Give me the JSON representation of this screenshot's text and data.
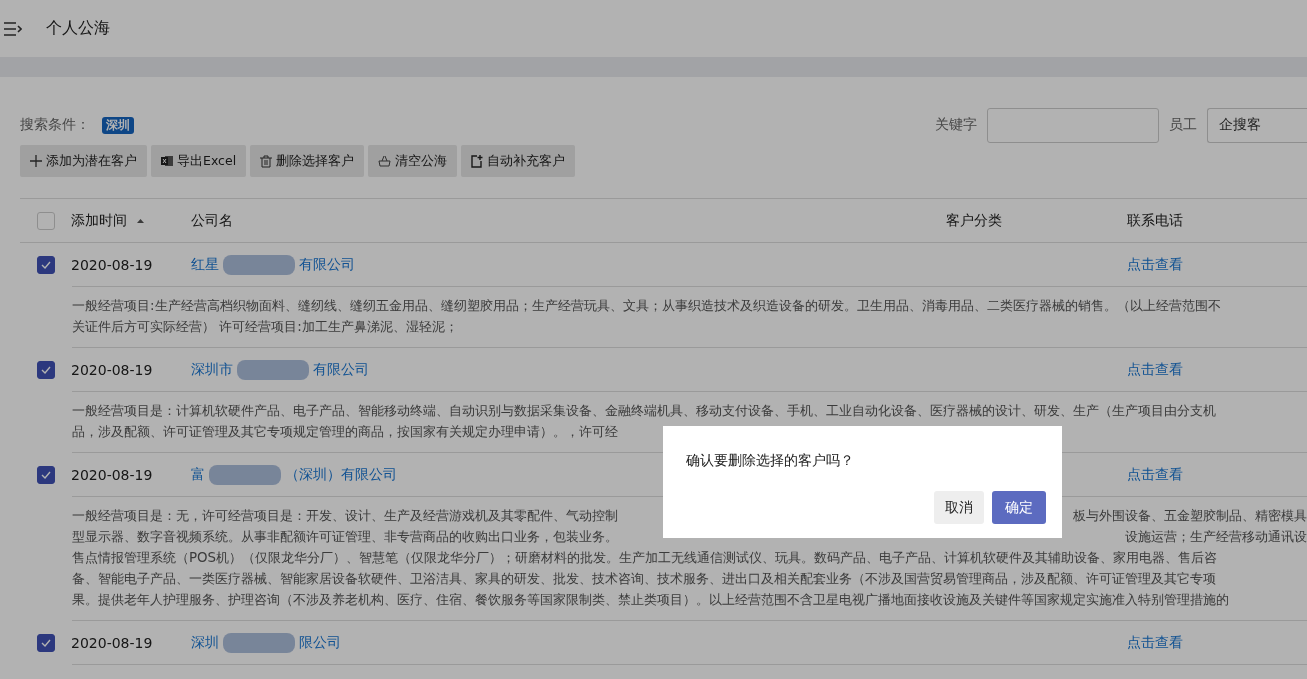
{
  "header": {
    "title": "个人公海"
  },
  "search": {
    "label": "搜索条件：",
    "tags": [
      "深圳"
    ],
    "keyword_label": "关键字",
    "employee_label": "员工",
    "employee_value": "企搜客"
  },
  "toolbar": [
    {
      "kind": "plus",
      "label": "添加为潜在客户"
    },
    {
      "kind": "excel",
      "label": "导出Excel"
    },
    {
      "kind": "trash",
      "label": "删除选择客户"
    },
    {
      "kind": "basket",
      "label": "清空公海"
    },
    {
      "kind": "refill",
      "label": "自动补充客户"
    }
  ],
  "table": {
    "select_all_checked": false,
    "columns": [
      "添加时间",
      "公司名",
      "客户分类",
      "联系电话"
    ],
    "rows": [
      {
        "checked": true,
        "date": "2020-08-19",
        "name_start": "红星",
        "name_end": "有限公司",
        "phone": "点击查看",
        "description": [
          [
            "一般经营项目:生产经营高档织物面料、缝纫线、缝纫五金用品、缝纫塑胶用品；生产经营玩具、文具；从事织造技术及织造设备的研发。卫生用品、消毒用品、二类医疗器械的销售。（以上经营范围不"
          ],
          [
            "关证件后方可实际经营） 许可经营项目:加工生产鼻涕泥、湿轻泥；"
          ]
        ]
      },
      {
        "checked": true,
        "date": "2020-08-19",
        "name_start": "深圳市",
        "name_end": "有限公司",
        "phone": "点击查看",
        "description": [
          [
            "一般经营项目是：计算机软硬件产品、电子产品、智能移动终端、自动识别与数据采集设备、金融终端机具、移动支付设备、手机、工业自动化设备、医疗器械的设计、研发、生产（生产项目由分支机"
          ],
          [
            "品，涉及配额、许可证管理及其它专项规定管理的商品，按国家有关规定办理申请）。，许可经"
          ]
        ]
      },
      {
        "checked": true,
        "date": "2020-08-19",
        "name_start": "富",
        "name_end": "（深圳）有限公司",
        "phone": "点击查看",
        "description": [
          [
            "一般经营项目是：无，许可经营项目是：开发、设计、生产及经营游戏机及其零配件、气动控制",
            "板与外围设备、五金塑胶制品、精密模具"
          ],
          [
            "型显示器、数字音视频系统。从事非配额许可证管理、非专营商品的收购出口业务，包装业务。",
            "设施运营；生产经营移动通讯设"
          ],
          [
            "售点情报管理系统（POS机）（仅限龙华分厂）、智慧笔（仅限龙华分厂）；研磨材料的批发。生产加工无线通信测试仪、玩具。数码产品、电子产品、计算机软硬件及其辅助设备、家用电器、售后咨"
          ],
          [
            "备、智能电子产品、一类医疗器械、智能家居设备软硬件、卫浴洁具、家具的研发、批发、技术咨询、技术服务、进出口及相关配套业务（不涉及国营贸易管理商品，涉及配额、许可证管理及其它专项"
          ],
          [
            "果。提供老年人护理服务、护理咨询（不涉及养老机构、医疗、住宿、餐饮服务等国家限制类、禁止类项目）。以上经营范围不含卫星电视广播地面接收设施及关键件等国家规定实施准入特别管理措施的"
          ]
        ]
      },
      {
        "checked": true,
        "date": "2020-08-19",
        "name_start": "深圳",
        "name_end": "限公司",
        "phone": "点击查看"
      }
    ]
  },
  "dialog": {
    "message": "确认要删除选择的客户吗？",
    "buttons": [
      {
        "kind": "cancel",
        "label": "取消"
      },
      {
        "kind": "confirm",
        "label": "确定"
      }
    ]
  }
}
